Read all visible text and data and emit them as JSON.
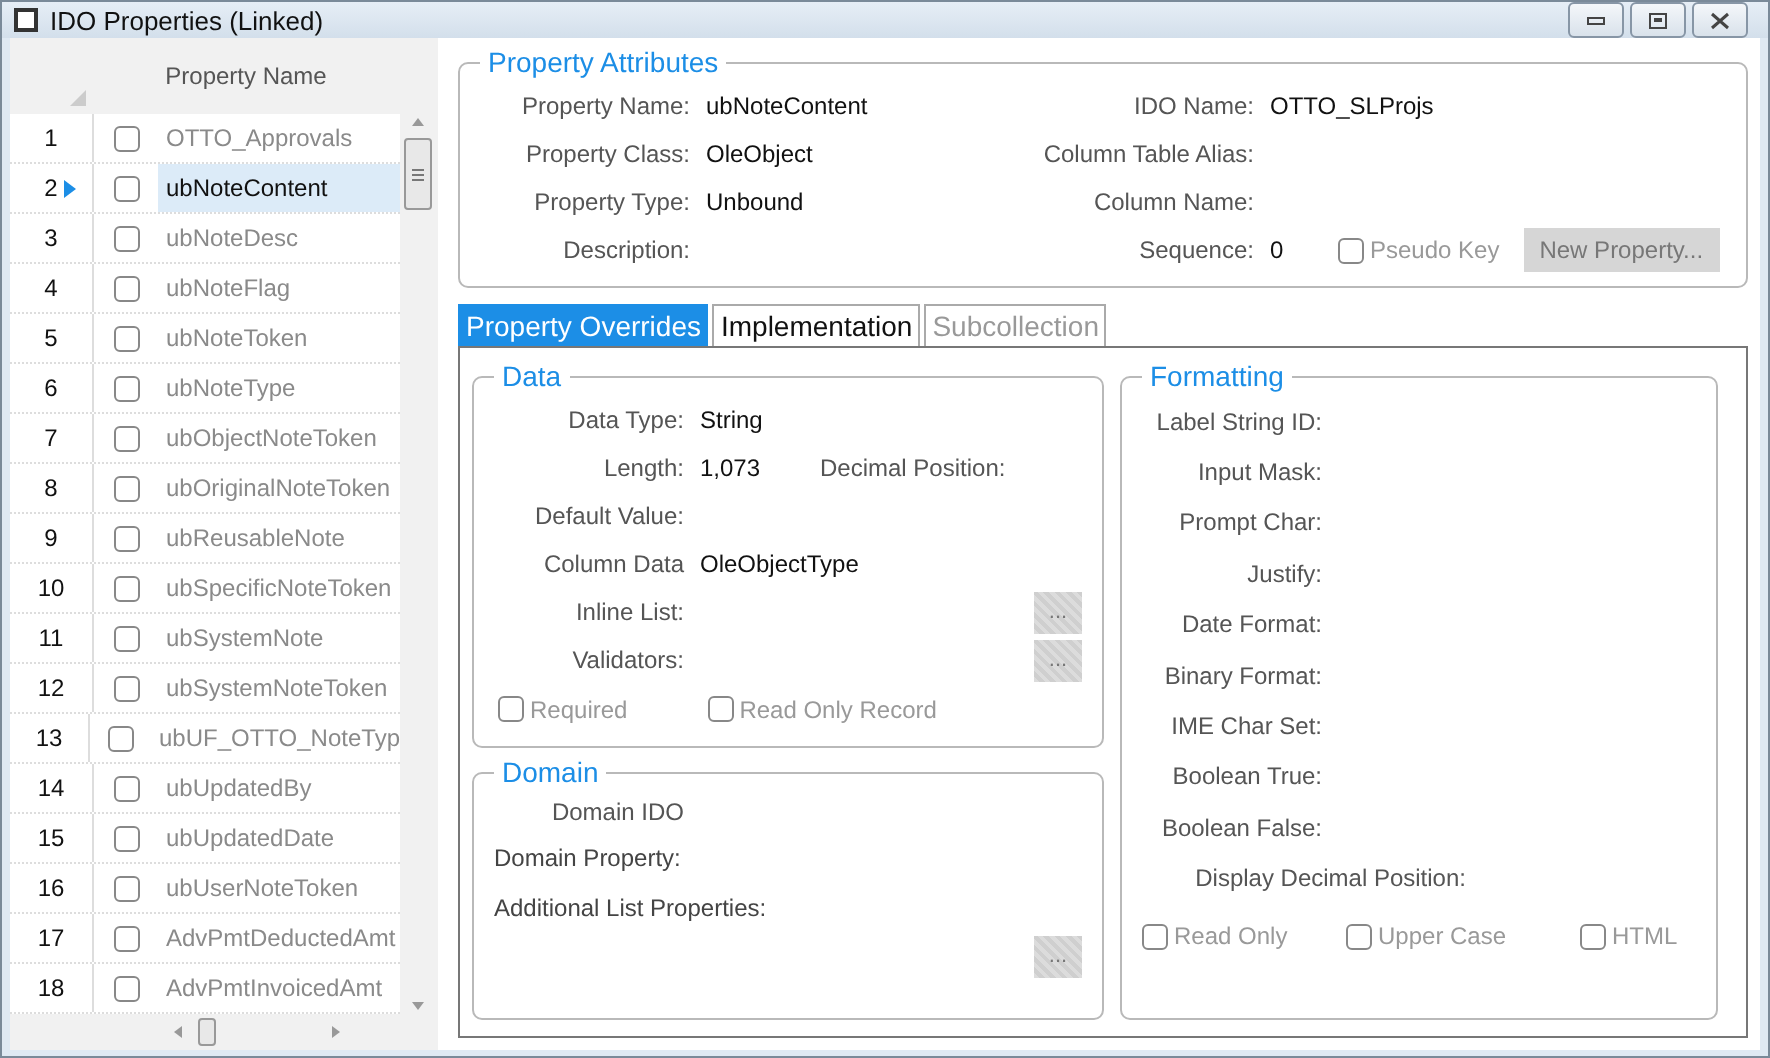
{
  "window": {
    "title": "IDO Properties (Linked)"
  },
  "grid": {
    "column": "Property Name",
    "rows": [
      {
        "number": "1",
        "name": "OTTO_Approvals",
        "checked": false,
        "selected": false
      },
      {
        "number": "2",
        "name": "ubNoteContent",
        "checked": false,
        "selected": true
      },
      {
        "number": "3",
        "name": "ubNoteDesc",
        "checked": false,
        "selected": false
      },
      {
        "number": "4",
        "name": "ubNoteFlag",
        "checked": false,
        "selected": false
      },
      {
        "number": "5",
        "name": "ubNoteToken",
        "checked": false,
        "selected": false
      },
      {
        "number": "6",
        "name": "ubNoteType",
        "checked": false,
        "selected": false
      },
      {
        "number": "7",
        "name": "ubObjectNoteToken",
        "checked": false,
        "selected": false
      },
      {
        "number": "8",
        "name": "ubOriginalNoteToken",
        "checked": false,
        "selected": false
      },
      {
        "number": "9",
        "name": "ubReusableNote",
        "checked": false,
        "selected": false
      },
      {
        "number": "10",
        "name": "ubSpecificNoteToken",
        "checked": false,
        "selected": false
      },
      {
        "number": "11",
        "name": "ubSystemNote",
        "checked": false,
        "selected": false
      },
      {
        "number": "12",
        "name": "ubSystemNoteToken",
        "checked": false,
        "selected": false
      },
      {
        "number": "13",
        "name": "ubUF_OTTO_NoteTyp",
        "checked": false,
        "selected": false
      },
      {
        "number": "14",
        "name": "ubUpdatedBy",
        "checked": false,
        "selected": false
      },
      {
        "number": "15",
        "name": "ubUpdatedDate",
        "checked": false,
        "selected": false
      },
      {
        "number": "16",
        "name": "ubUserNoteToken",
        "checked": false,
        "selected": false
      },
      {
        "number": "17",
        "name": "AdvPmtDeductedAmt",
        "checked": false,
        "selected": false
      },
      {
        "number": "18",
        "name": "AdvPmtInvoicedAmt",
        "checked": false,
        "selected": false
      }
    ]
  },
  "property_attributes": {
    "title": "Property Attributes",
    "left": [
      {
        "label": "Property Name:",
        "value": "ubNoteContent"
      },
      {
        "label": "Property Class:",
        "value": "OleObject"
      },
      {
        "label": "Property Type:",
        "value": "Unbound"
      },
      {
        "label": "Description:"
      }
    ],
    "right": [
      {
        "label": "IDO Name:",
        "value": "OTTO_SLProjs"
      },
      {
        "label": "Column Table Alias:"
      },
      {
        "label": "Column Name:"
      },
      {
        "label": "Sequence:",
        "value": "0"
      }
    ],
    "pseudo_key": {
      "label": "Pseudo Key",
      "checked": false,
      "disabled": true
    },
    "new_property_button": {
      "label": "New Property...",
      "disabled": true
    }
  },
  "tabs": [
    {
      "label": "Property Overrides",
      "selected": true,
      "disabled": false
    },
    {
      "label": "Implementation",
      "selected": false,
      "disabled": false
    },
    {
      "label": "Subcollection",
      "selected": false,
      "disabled": true
    }
  ],
  "data": {
    "title": "Data",
    "fields": [
      {
        "label": "Data Type:",
        "value": "String"
      },
      {
        "label": "Length:",
        "value": "1,073",
        "extra_label": "Decimal Position:"
      },
      {
        "label": "Default Value:"
      },
      {
        "label": "Column Data",
        "value": "OleObjectType"
      },
      {
        "label": "Inline List:",
        "button": "..."
      },
      {
        "label": "Validators:",
        "button": "..."
      }
    ],
    "checkboxes": [
      {
        "label": "Required",
        "checked": false,
        "disabled": true
      },
      {
        "label": "Read Only Record",
        "checked": false,
        "disabled": true
      }
    ]
  },
  "domain": {
    "title": "Domain",
    "fields": [
      {
        "label": "Domain IDO",
        "kind": "indented"
      },
      {
        "label": "Domain Property:",
        "kind": "left"
      },
      {
        "label": "Additional List Properties:",
        "kind": "left"
      }
    ],
    "button": "..."
  },
  "formatting": {
    "title": "Formatting",
    "fields": [
      {
        "label": "Label String ID:"
      },
      {
        "label": "Input Mask:"
      },
      {
        "label": "Prompt Char:"
      },
      {
        "label": "Justify:"
      },
      {
        "label": "Date Format:"
      },
      {
        "label": "Binary Format:"
      },
      {
        "label": "IME Char Set:"
      },
      {
        "label": "Boolean True:"
      },
      {
        "label": "Boolean False:"
      },
      {
        "label": "Display Decimal Position:",
        "kind": "wide"
      }
    ],
    "checkboxes": [
      {
        "label": "Read Only",
        "checked": false,
        "disabled": true
      },
      {
        "label": "Upper Case",
        "checked": false,
        "disabled": true
      },
      {
        "label": "HTML",
        "checked": false,
        "disabled": true
      }
    ]
  }
}
